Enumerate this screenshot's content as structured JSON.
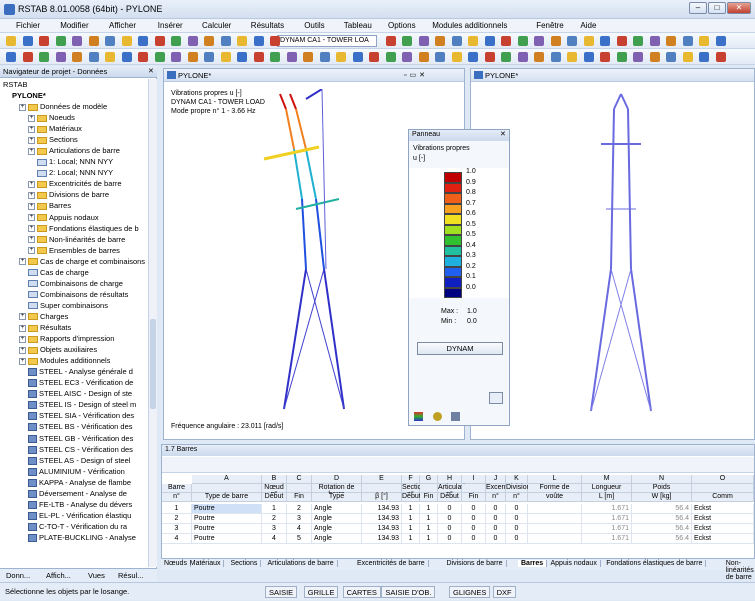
{
  "app": {
    "title": "RSTAB 8.01.0058 (64bit) - PYLONE"
  },
  "menu": [
    "Fichier",
    "Modifier",
    "Afficher",
    "Insérer",
    "Calculer",
    "Résultats",
    "Outils",
    "Tableau",
    "Options",
    "Modules additionnels",
    "Fenêtre",
    "Aide"
  ],
  "toolbar": {
    "loadcase": "DYNAM CA1 - TOWER LOA"
  },
  "navigator": {
    "title": "Navigateur de projet - Données",
    "root": "RSTAB",
    "model": "PYLONE*",
    "items": [
      {
        "label": "Données de modèle",
        "type": "folder",
        "indent": 1
      },
      {
        "label": "Noeuds",
        "type": "folder",
        "indent": 2
      },
      {
        "label": "Matériaux",
        "type": "folder",
        "indent": 2
      },
      {
        "label": "Sections",
        "type": "folder",
        "indent": 2
      },
      {
        "label": "Articulations de barre",
        "type": "folder",
        "indent": 2
      },
      {
        "label": "1: Local; NNN NYY",
        "type": "item",
        "indent": 3
      },
      {
        "label": "2: Local; NNN NYY",
        "type": "item",
        "indent": 3
      },
      {
        "label": "Excentricités de barre",
        "type": "folder",
        "indent": 2
      },
      {
        "label": "Divisions de barre",
        "type": "folder",
        "indent": 2
      },
      {
        "label": "Barres",
        "type": "folder",
        "indent": 2
      },
      {
        "label": "Appuis nodaux",
        "type": "folder",
        "indent": 2
      },
      {
        "label": "Fondations élastiques de b",
        "type": "folder",
        "indent": 2
      },
      {
        "label": "Non-linéarités de barre",
        "type": "folder",
        "indent": 2
      },
      {
        "label": "Ensembles de barres",
        "type": "folder",
        "indent": 2
      },
      {
        "label": "Cas de charge et combinaisons",
        "type": "folder",
        "indent": 1
      },
      {
        "label": "Cas de charge",
        "type": "item",
        "indent": 2
      },
      {
        "label": "Combinaisons de charge",
        "type": "item",
        "indent": 2
      },
      {
        "label": "Combinaisons de résultats",
        "type": "item",
        "indent": 2
      },
      {
        "label": "Super combinaisons",
        "type": "item",
        "indent": 2
      },
      {
        "label": "Charges",
        "type": "folder",
        "indent": 1
      },
      {
        "label": "Résultats",
        "type": "folder",
        "indent": 1
      },
      {
        "label": "Rapports d'impression",
        "type": "folder",
        "indent": 1
      },
      {
        "label": "Objets auxiliaires",
        "type": "folder",
        "indent": 1
      },
      {
        "label": "Modules additionnels",
        "type": "folder",
        "indent": 1
      },
      {
        "label": "STEEL - Analyse générale d",
        "type": "module",
        "indent": 2
      },
      {
        "label": "STEEL EC3 - Vérification de",
        "type": "module",
        "indent": 2
      },
      {
        "label": "STEEL AISC - Design of ste",
        "type": "module",
        "indent": 2
      },
      {
        "label": "STEEL IS - Design of steel m",
        "type": "module",
        "indent": 2
      },
      {
        "label": "STEEL SIA - Vérification des",
        "type": "module",
        "indent": 2
      },
      {
        "label": "STEEL BS - Vérification des",
        "type": "module",
        "indent": 2
      },
      {
        "label": "STEEL GB - Vérification des",
        "type": "module",
        "indent": 2
      },
      {
        "label": "STEEL CS - Vérification des",
        "type": "module",
        "indent": 2
      },
      {
        "label": "STEEL AS - Design of steel",
        "type": "module",
        "indent": 2
      },
      {
        "label": "ALUMINIUM - Vérification",
        "type": "module",
        "indent": 2
      },
      {
        "label": "KAPPA - Analyse de flambe",
        "type": "module",
        "indent": 2
      },
      {
        "label": "Déversement - Analyse de",
        "type": "module",
        "indent": 2
      },
      {
        "label": "FE-LTB - Analyse du dévers",
        "type": "module",
        "indent": 2
      },
      {
        "label": "EL-PL - Vérification élastiqu",
        "type": "module",
        "indent": 2
      },
      {
        "label": "C-TO-T - Vérification du ra",
        "type": "module",
        "indent": 2
      },
      {
        "label": "PLATE-BUCKLING - Analyse",
        "type": "module",
        "indent": 2
      }
    ],
    "tabs": [
      "Donn...",
      "Affich...",
      "Vues",
      "Résul..."
    ]
  },
  "view1": {
    "title": "PYLONE*",
    "info": [
      "Vibrations propres  u [-]",
      "DYNAM CA1 - TOWER LOAD",
      "Mode propre n° 1 - 3.66 Hz"
    ],
    "footer": "Fréquence angulaire : 23.011 [rad/s]"
  },
  "view2": {
    "title": "PYLONE*"
  },
  "panel": {
    "title": "Panneau",
    "heading": "Vibrations propres",
    "unit": "u [-]",
    "legend": [
      {
        "v": "1.0",
        "c": "#c00000"
      },
      {
        "v": "0.9",
        "c": "#e02010"
      },
      {
        "v": "0.8",
        "c": "#f06018"
      },
      {
        "v": "0.7",
        "c": "#f8a020"
      },
      {
        "v": "0.6",
        "c": "#f0e020"
      },
      {
        "v": "0.5",
        "c": "#a0e020"
      },
      {
        "v": "0.5",
        "c": "#30c030"
      },
      {
        "v": "0.4",
        "c": "#20c0a0"
      },
      {
        "v": "0.3",
        "c": "#20b0e0"
      },
      {
        "v": "0.2",
        "c": "#2060f0"
      },
      {
        "v": "0.1",
        "c": "#1020c0"
      },
      {
        "v": "0.0",
        "c": "#000080"
      }
    ],
    "max_label": "Max :",
    "max": "1.0",
    "min_label": "Min :",
    "min": "0.0",
    "button": "DYNAM"
  },
  "table": {
    "title": "1.7 Barres",
    "letters": [
      "A",
      "B",
      "C",
      "D",
      "E",
      "F",
      "G",
      "H",
      "I",
      "J",
      "K",
      "L",
      "M",
      "N",
      "O"
    ],
    "head1": [
      "Barre",
      "",
      "Nœud n°",
      "",
      "Rotation de barre",
      "",
      "Section n°",
      "",
      "Articulation n°",
      "",
      "Excentr.",
      "Division",
      "Forme de",
      "Longueur",
      "Poids",
      ""
    ],
    "head2": [
      "n°",
      "Type de barre",
      "Début",
      "Fin",
      "Type",
      "β [°]",
      "Début",
      "Fin",
      "Début",
      "Fin",
      "n°",
      "n°",
      "voûte",
      "L [m]",
      "W [kg]",
      "Comm"
    ],
    "rows": [
      [
        "1",
        "Poutre",
        "1",
        "2",
        "Angle",
        "134.93",
        "1",
        "1",
        "0",
        "0",
        "0",
        "0",
        "",
        "1.671",
        "56.4",
        "Eckst"
      ],
      [
        "2",
        "Poutre",
        "2",
        "3",
        "Angle",
        "134.93",
        "1",
        "1",
        "0",
        "0",
        "0",
        "0",
        "",
        "1.671",
        "56.4",
        "Eckst"
      ],
      [
        "3",
        "Poutre",
        "3",
        "4",
        "Angle",
        "134.93",
        "1",
        "1",
        "0",
        "0",
        "0",
        "0",
        "",
        "1.671",
        "56.4",
        "Eckst"
      ],
      [
        "4",
        "Poutre",
        "4",
        "5",
        "Angle",
        "134.93",
        "1",
        "1",
        "0",
        "0",
        "0",
        "0",
        "",
        "1.671",
        "56.4",
        "Eckst"
      ]
    ]
  },
  "sheets": [
    "Nœuds",
    "Matériaux",
    "Sections",
    "Articulations de barre",
    "Excentricités de barre",
    "Divisions de barre",
    "Barres",
    "Appuis nodaux",
    "Fondations élastiques de barre",
    "Non-linéarités de barre"
  ],
  "status": {
    "text": "Sélectionne les objets par le losange.",
    "buttons": [
      "SAISIE",
      "GRILLE",
      "CARTES",
      "SAISIE D'OB.",
      "GLIGNES",
      "DXF"
    ]
  }
}
